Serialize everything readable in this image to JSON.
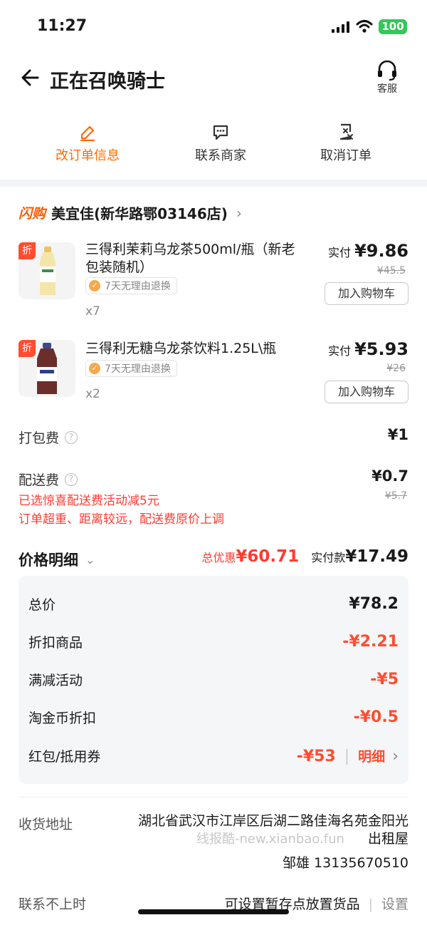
{
  "status_bar": {
    "time": "11:27",
    "battery": "100"
  },
  "header": {
    "title": "正在召唤骑士",
    "service_label": "客服"
  },
  "actions": [
    {
      "label": "改订单信息"
    },
    {
      "label": "联系商家"
    },
    {
      "label": "取消订单"
    }
  ],
  "store": {
    "flash_tag": "闪购",
    "name": "美宜佳(新华路鄂03146店)"
  },
  "products": [
    {
      "tag": "折",
      "name": "三得利茉莉乌龙茶500ml/瓶（新老包装随机）",
      "badge": "7天无理由退换",
      "qty": "x7",
      "paid_label": "实付",
      "paid": "¥9.86",
      "original": "¥45.5",
      "add_cart": "加入购物车"
    },
    {
      "tag": "折",
      "name": "三得利无糖乌龙茶饮料1.25L\\瓶",
      "badge": "7天无理由退换",
      "qty": "x2",
      "paid_label": "实付",
      "paid": "¥5.93",
      "original": "¥26",
      "add_cart": "加入购物车"
    }
  ],
  "fees": {
    "packing_label": "打包费",
    "packing_value": "¥1",
    "delivery_label": "配送费",
    "delivery_value": "¥0.7",
    "delivery_original": "¥5.7",
    "note1": "已选惊喜配送费活动减5元",
    "note2": "订单超重、距离较远，配送费原价上调"
  },
  "price_detail": {
    "title": "价格明细",
    "total_discount_label": "总优惠",
    "total_discount": "¥60.71",
    "actual_label": "实付款",
    "actual": "¥17.49",
    "rows": [
      {
        "label": "总价",
        "value": "¥78.2"
      },
      {
        "label": "折扣商品",
        "value": "-¥2.21"
      },
      {
        "label": "满减活动",
        "value": "-¥5"
      },
      {
        "label": "淘金币折扣",
        "value": "-¥0.5"
      },
      {
        "label": "红包/抵用券",
        "value": "-¥53",
        "link": "明细"
      }
    ]
  },
  "address": {
    "label": "收货地址",
    "line1": "湖北省武汉市江岸区后湖二路佳海名苑金阳光",
    "line2": "出租屋",
    "watermark": "线报酷-new.xianbao.fun",
    "contact": "邹雄 13135670510"
  },
  "footer": {
    "unreachable_label": "联系不上时",
    "storage_text": "可设置暂存点放置货品",
    "set_label": "设置"
  }
}
